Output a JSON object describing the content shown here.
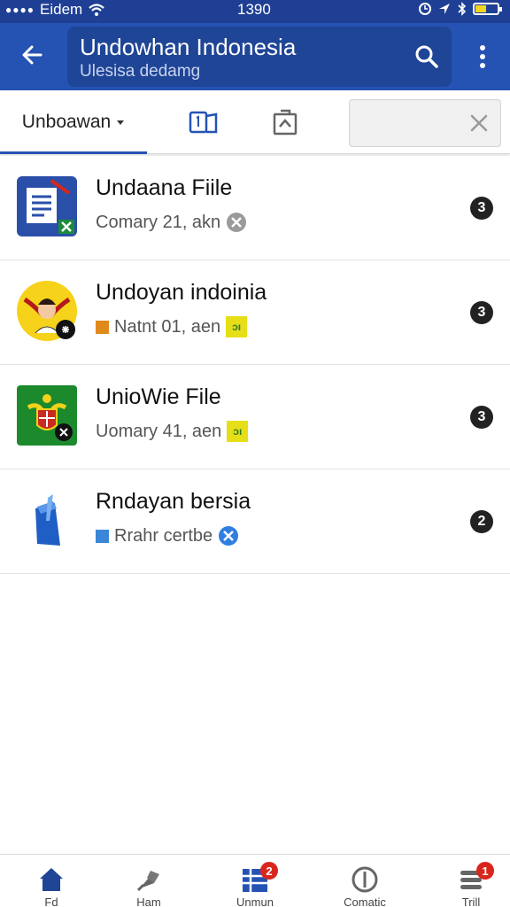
{
  "status_bar": {
    "carrier": "Eidem",
    "time": "1390"
  },
  "app_bar": {
    "title": "Undowhan Indonesia",
    "subtitle": "Ulesisa dedamg",
    "back_icon": "arrow-left-icon",
    "search_icon": "search-icon",
    "menu_icon": "more-vertical-icon"
  },
  "tabs": {
    "active_label": "Unboawan",
    "icons": [
      "document-number-icon",
      "upload-box-icon"
    ],
    "search_value": "",
    "clear_icon": "close-icon"
  },
  "files": [
    {
      "title": "Undaana Fiile",
      "meta": "Comary 21, akn",
      "count": "3",
      "icon": "document-excel-icon",
      "badge": "gray-close-icon"
    },
    {
      "title": "Undoyan indoinia",
      "meta": "Natnt 01, aen",
      "count": "3",
      "icon": "garuda-emblem-icon",
      "badge": "yellow-tag-icon",
      "badge_text": "ɔı",
      "square_color": "#e08a1e"
    },
    {
      "title": "UnioWie File",
      "meta": "Uomary 41, aen",
      "count": "3",
      "icon": "coat-of-arms-icon",
      "badge": "yellow-tag-icon",
      "badge_text": "ɔı"
    },
    {
      "title": "Rndayan bersia",
      "meta": "Rrahr certbe",
      "count": "2",
      "icon": "blue-pen-file-icon",
      "badge": "blue-close-icon",
      "square_color": "#3b86d8"
    }
  ],
  "bottom_nav": [
    {
      "label": "Fd",
      "icon": "home-icon"
    },
    {
      "label": "Ham",
      "icon": "pin-icon"
    },
    {
      "label": "Unmun",
      "icon": "grid-list-icon",
      "badge": "2"
    },
    {
      "label": "Comatic",
      "icon": "circle-line-icon"
    },
    {
      "label": "Trill",
      "icon": "stack-icon",
      "badge": "1"
    }
  ],
  "colors": {
    "app_bar": "#2553b4",
    "status_bar": "#1f3f94",
    "search_box": "#1f4596",
    "badge_red": "#d9261c",
    "count_badge": "#222222"
  }
}
